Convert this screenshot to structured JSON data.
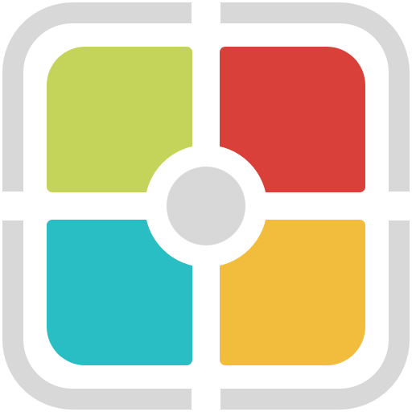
{
  "icon": {
    "name": "four-color-quadrant-app-icon",
    "colors": {
      "frame": "#d8d8d8",
      "background": "#ffffff",
      "top_left": "#c4d45a",
      "top_right": "#d9403a",
      "bottom_left": "#29bec4",
      "bottom_right": "#f2bd3c",
      "center_dot": "#d8d8d8"
    }
  }
}
